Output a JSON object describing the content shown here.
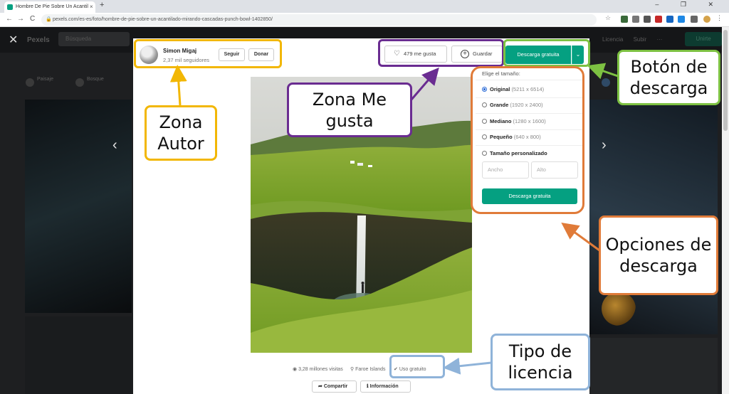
{
  "browser": {
    "tab_title": "Hombre De Pie Sobre Un Acantil",
    "tab_close": "×",
    "new_tab": "+",
    "window_controls": "–  ❐  ✕",
    "url": "pexels.com/es-es/foto/hombre-de-pie-sobre-un-acantilado-mirando-cascadas-punch-bowl-1402850/",
    "nav_back": "←",
    "nav_forward": "→",
    "nav_reload": "C"
  },
  "background_page": {
    "logo": "Pexels",
    "search_placeholder": "Búsqueda",
    "right_menu": "Licencia Subir ···",
    "join_button": "Unirte",
    "chips": [
      "Paisaje",
      "Bosque"
    ],
    "close_symbol": "✕",
    "prev_arrow": "‹",
    "next_arrow": "›"
  },
  "author": {
    "name": "Simon Migaj",
    "followers": "2,37 mil seguidores",
    "follow_button": "Seguir",
    "donate_button": "Donar"
  },
  "actions": {
    "like_label": "479 me gusta",
    "save_label": "Guardar",
    "download_label": "Descarga gratuita",
    "download_caret": "⌄"
  },
  "download_options": {
    "title": "Elige el tamaño:",
    "options": [
      {
        "label": "Original",
        "size": "(5211 x 6514)",
        "selected": true
      },
      {
        "label": "Grande",
        "size": "(1920 x 2400)",
        "selected": false
      },
      {
        "label": "Mediano",
        "size": "(1280 x 1600)",
        "selected": false
      },
      {
        "label": "Pequeño",
        "size": "(640 x 800)",
        "selected": false
      },
      {
        "label": "Tamaño personalizado",
        "size": "",
        "selected": false
      }
    ],
    "width_placeholder": "Ancho",
    "height_placeholder": "Alto",
    "button": "Descarga gratuita"
  },
  "photo_info": {
    "views": "3,28 millones visitas",
    "location": "Faroe Islands",
    "license": "Uso gratuito",
    "share_button": "Compartir",
    "info_button": "Información"
  },
  "annotations": {
    "author_zone": "Zona Autor",
    "like_zone": "Zona Me gusta",
    "download_button": "Botón de descarga",
    "download_options": "Opciones de descarga",
    "license_type": "Tipo de licencia"
  },
  "colors": {
    "yellow": "#f2b705",
    "purple": "#6a2c91",
    "green": "#7dc142",
    "orange": "#e07b39",
    "blue": "#8fb3d9",
    "pexels_green": "#05a081"
  }
}
